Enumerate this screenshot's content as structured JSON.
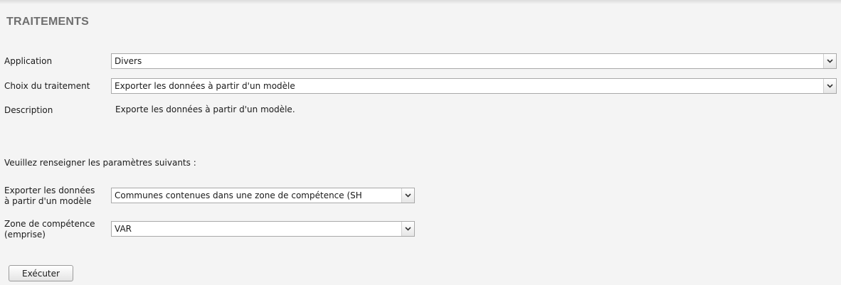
{
  "page": {
    "title": "TRAITEMENTS"
  },
  "form": {
    "application": {
      "label": "Application",
      "value": "Divers"
    },
    "treatment": {
      "label": "Choix du traitement",
      "value": "Exporter les données à partir d'un modèle"
    },
    "description": {
      "label": "Description",
      "value": "Exporte les données à partir d'un modèle."
    }
  },
  "parameters": {
    "intro": "Veuillez renseigner les paramètres suivants :",
    "export_model": {
      "label_line1": "Exporter les données",
      "label_line2": "à partir d'un modèle",
      "value": "Communes contenues dans une zone de compétence (SH"
    },
    "zone": {
      "label_line1": "Zone de compétence",
      "label_line2": "(emprise)",
      "value": "VAR"
    }
  },
  "actions": {
    "execute_label": "Exécuter"
  },
  "icons": {
    "dropdown": "chevron-down-icon"
  }
}
